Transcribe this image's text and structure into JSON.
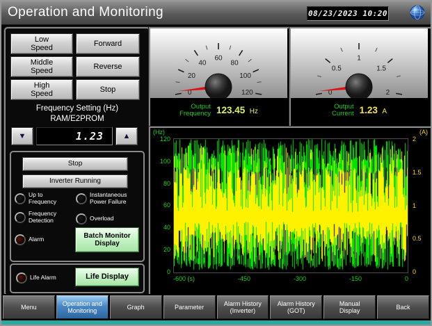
{
  "header": {
    "title": "Operation and Monitoring",
    "datetime": "08/23/2023 10:20"
  },
  "controls": {
    "speed_buttons": [
      "Low\nSpeed",
      "Middle\nSpeed",
      "High\nSpeed"
    ],
    "command_buttons": [
      "Forward",
      "Reverse",
      "Stop"
    ],
    "frequency_setting_label": "Frequency Setting (Hz)",
    "memory_label": "RAM/E2PROM",
    "frequency_value": "1.23",
    "down_arrow": "▼",
    "up_arrow": "▲",
    "stop_status_button": "Stop",
    "running_status_button": "Inverter Running",
    "lamps": [
      {
        "label": "Up to\nFrequency",
        "color": "#1b1b1b"
      },
      {
        "label": "Instantaneous\nPower Failure",
        "color": "#1b1b1b"
      },
      {
        "label": "Frequency\nDetection",
        "color": "#1b1b1b"
      },
      {
        "label": "Overload",
        "color": "#1b1b1b"
      },
      {
        "label": "Alarm",
        "color": "#5a150a"
      },
      {
        "label": "Life Alarm",
        "color": "#5a150a"
      }
    ],
    "batch_monitor_button": "Batch Monitor\nDisplay",
    "life_display_button": "Life Display"
  },
  "gauges": [
    {
      "label": "Output\nFrequency",
      "value": "123.45",
      "unit": "Hz",
      "min": 0,
      "max": 120,
      "ticks": [
        0,
        20,
        40,
        60,
        80,
        100,
        120
      ],
      "needle_color": "#e01010",
      "value_color": "#dff060"
    },
    {
      "label": "Output\nCurrent",
      "value": "1.23",
      "unit": "A",
      "min": 0,
      "max": 2,
      "ticks": [
        0,
        0.5,
        1,
        1.5,
        2
      ],
      "needle_color": "#e01010",
      "value_color": "#f5e24a"
    }
  ],
  "chart_data": {
    "type": "line",
    "title": "",
    "x_axis": {
      "ticks": [
        "-600 (s)",
        "-450",
        "-300",
        "-150",
        "0"
      ],
      "range_seconds": [
        -600,
        0
      ],
      "unit": "s"
    },
    "left_axis": {
      "unit": "(Hz)",
      "ticks": [
        120,
        100,
        80,
        60,
        40,
        20,
        0
      ],
      "range": [
        0,
        120
      ],
      "color": "#1fd41f"
    },
    "right_axis": {
      "unit": "(A)",
      "ticks": [
        2,
        1.5,
        1,
        0.5,
        0
      ],
      "range": [
        0,
        2
      ],
      "color": "#ffd416"
    },
    "series": [
      {
        "name": "Output Frequency",
        "axis": "left",
        "color": "#00e400",
        "description": "dense random noise spanning approx 5-120 Hz over the last 600 s"
      },
      {
        "name": "Output Current",
        "axis": "right",
        "color": "#fff200",
        "description": "dense random noise spanning approx 0.1-2 A over the last 600 s"
      }
    ],
    "grid": true,
    "legend": "none"
  },
  "nav": {
    "items": [
      {
        "label": "Menu",
        "active": false
      },
      {
        "label": "Operation and\nMonitoring",
        "active": true
      },
      {
        "label": "Graph",
        "active": false
      },
      {
        "label": "Parameter",
        "active": false
      },
      {
        "label": "Alarm History\n(Inverter)",
        "active": false
      },
      {
        "label": "Alarm History\n(GOT)",
        "active": false
      },
      {
        "label": "Manual\nDisplay",
        "active": false
      },
      {
        "label": "Back",
        "active": false
      }
    ]
  },
  "colors": {
    "nav_active": "#4a88c4",
    "label_green": "#1ecf1e",
    "teal_strip": "#2ba8a0"
  }
}
